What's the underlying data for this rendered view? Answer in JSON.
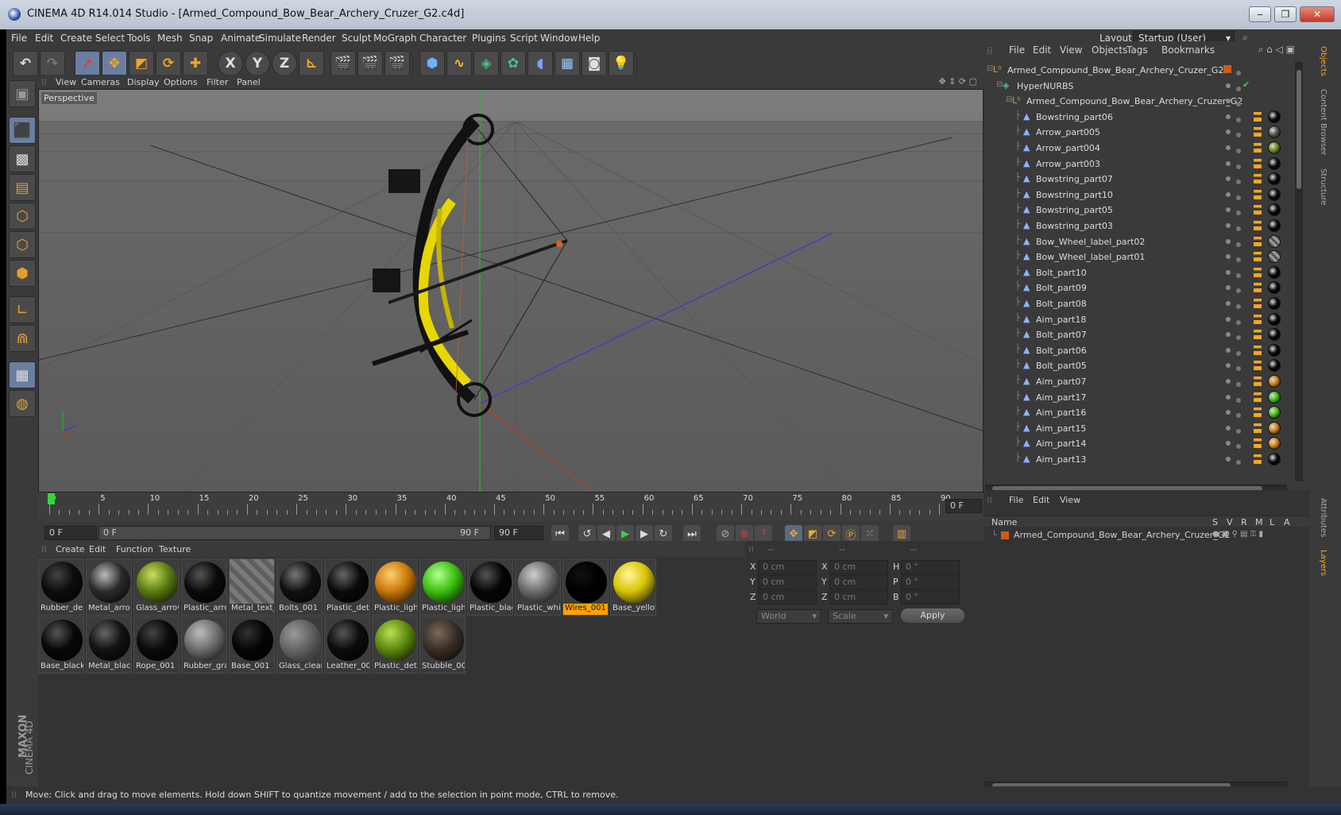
{
  "window": {
    "title": "CINEMA 4D R14.014 Studio - [Armed_Compound_Bow_Bear_Archery_Cruzer_G2.c4d]"
  },
  "menubar": {
    "items": [
      "File",
      "Edit",
      "Create",
      "Select",
      "Tools",
      "Mesh",
      "Snap",
      "Animate",
      "Simulate",
      "Render",
      "Sculpt",
      "MoGraph",
      "Character",
      "Plugins",
      "Script",
      "Window",
      "Help"
    ],
    "layout_label": "Layout:",
    "layout_value": "Startup (User)"
  },
  "toolbar": {
    "axis_x": "X",
    "axis_y": "Y",
    "axis_z": "Z"
  },
  "viewport": {
    "menu": [
      "View",
      "Cameras",
      "Display",
      "Options",
      "Filter",
      "Panel"
    ],
    "label": "Perspective"
  },
  "timeline": {
    "ticks": [
      "0",
      "5",
      "10",
      "15",
      "20",
      "25",
      "30",
      "35",
      "40",
      "45",
      "50",
      "55",
      "60",
      "65",
      "70",
      "75",
      "80",
      "85",
      "90"
    ],
    "current_frame": "0 F",
    "start_field": "0 F",
    "range_start": "0 F",
    "range_end": "90 F",
    "end_field": "90 F"
  },
  "materials": {
    "menu": [
      "Create",
      "Edit",
      "Function",
      "Texture"
    ],
    "row1": [
      {
        "label": "Rubber_de",
        "color": "#0c0c0c",
        "hi": "#444"
      },
      {
        "label": "Metal_arro",
        "color": "#2b2b2b",
        "hi": "#bbb"
      },
      {
        "label": "Glass_arrov",
        "color": "#5a7a12",
        "hi": "#c8e060"
      },
      {
        "label": "Plastic_arro",
        "color": "#0a0a0a",
        "hi": "#555"
      },
      {
        "label": "Metal_text_",
        "color": "stripe",
        "hi": "#999"
      },
      {
        "label": "Bolts_001",
        "color": "#111",
        "hi": "#777"
      },
      {
        "label": "Plastic_deta",
        "color": "#0a0a0a",
        "hi": "#666"
      },
      {
        "label": "Plastic_ligh",
        "color": "#c87808",
        "hi": "#ffcf70"
      },
      {
        "label": "Plastic_ligh",
        "color": "#3ac010",
        "hi": "#b8ff90"
      },
      {
        "label": "Plastic_blac",
        "color": "#050505",
        "hi": "#555"
      },
      {
        "label": "Plastic_whi",
        "color": "#6c6c6c",
        "hi": "#cfcfcf"
      },
      {
        "label": "Wires_001",
        "color": "#000",
        "hi": "#111",
        "selected": true
      },
      {
        "label": "Base_yellov",
        "color": "#d8c400",
        "hi": "#fff7a0"
      }
    ],
    "row2": [
      {
        "label": "Base_black",
        "color": "#080808",
        "hi": "#555"
      },
      {
        "label": "Metal_blac",
        "color": "#121212",
        "hi": "#666"
      },
      {
        "label": "Rope_001",
        "color": "#0a0a0a",
        "hi": "#444"
      },
      {
        "label": "Rubber_gra",
        "color": "#6d6d6d",
        "hi": "#bdbdbd"
      },
      {
        "label": "Base_001",
        "color": "#050505",
        "hi": "#333"
      },
      {
        "label": "Glass_clear",
        "color": "stripe2",
        "hi": "#aaa"
      },
      {
        "label": "Leather_00",
        "color": "#0b0b0b",
        "hi": "#555"
      },
      {
        "label": "Plastic_deta",
        "color": "#5c8a10",
        "hi": "#b8e050"
      },
      {
        "label": "Stubble_00",
        "color": "#3a2e26",
        "hi": "#7a6a5c"
      }
    ]
  },
  "coordinates": {
    "header": [
      "--",
      "--",
      "--"
    ],
    "rows": [
      {
        "a": "X",
        "av": "0 cm",
        "b": "X",
        "bv": "0 cm",
        "c": "H",
        "cv": "0 °"
      },
      {
        "a": "Y",
        "av": "0 cm",
        "b": "Y",
        "bv": "0 cm",
        "c": "P",
        "cv": "0 °"
      },
      {
        "a": "Z",
        "av": "0 cm",
        "b": "Z",
        "bv": "0 cm",
        "c": "B",
        "cv": "0 °"
      }
    ],
    "world": "World",
    "scale": "Scale",
    "apply": "Apply"
  },
  "objects": {
    "menu": [
      "File",
      "Edit",
      "View",
      "Objects",
      "Tags",
      "Bookmarks"
    ],
    "items": [
      {
        "name": "Armed_Compound_Bow_Bear_Archery_Cruzer_G2",
        "indent": 0,
        "icon": "null",
        "tag": "orange-square"
      },
      {
        "name": "HyperNURBS",
        "indent": 1,
        "icon": "nurbs",
        "tag": "check"
      },
      {
        "name": "Armed_Compound_Bow_Bear_Archery_Cruzer_G2",
        "indent": 2,
        "icon": "null",
        "tag": "none"
      },
      {
        "name": "Bowstring_part06",
        "indent": 3,
        "icon": "poly",
        "tag": "#0a0a0a"
      },
      {
        "name": "Arrow_part005",
        "indent": 3,
        "icon": "poly",
        "tag": "#555"
      },
      {
        "name": "Arrow_part004",
        "indent": 3,
        "icon": "poly",
        "tag": "#6a8a1a"
      },
      {
        "name": "Arrow_part003",
        "indent": 3,
        "icon": "poly",
        "tag": "#0a0a0a"
      },
      {
        "name": "Bowstring_part07",
        "indent": 3,
        "icon": "poly",
        "tag": "#0a0a0a"
      },
      {
        "name": "Bowstring_part10",
        "indent": 3,
        "icon": "poly",
        "tag": "#0a0a0a"
      },
      {
        "name": "Bowstring_part05",
        "indent": 3,
        "icon": "poly",
        "tag": "#0a0a0a"
      },
      {
        "name": "Bowstring_part03",
        "indent": 3,
        "icon": "poly",
        "tag": "#0a0a0a"
      },
      {
        "name": "Bow_Wheel_label_part02",
        "indent": 3,
        "icon": "poly",
        "tag": "stripe"
      },
      {
        "name": "Bow_Wheel_label_part01",
        "indent": 3,
        "icon": "poly",
        "tag": "stripe"
      },
      {
        "name": "Bolt_part10",
        "indent": 3,
        "icon": "poly",
        "tag": "#0a0a0a"
      },
      {
        "name": "Bolt_part09",
        "indent": 3,
        "icon": "poly",
        "tag": "#0a0a0a"
      },
      {
        "name": "Bolt_part08",
        "indent": 3,
        "icon": "poly",
        "tag": "#0a0a0a"
      },
      {
        "name": "Aim_part18",
        "indent": 3,
        "icon": "poly",
        "tag": "#0a0a0a"
      },
      {
        "name": "Bolt_part07",
        "indent": 3,
        "icon": "poly",
        "tag": "#0a0a0a"
      },
      {
        "name": "Bolt_part06",
        "indent": 3,
        "icon": "poly",
        "tag": "#0a0a0a"
      },
      {
        "name": "Bolt_part05",
        "indent": 3,
        "icon": "poly",
        "tag": "#0a0a0a"
      },
      {
        "name": "Aim_part07",
        "indent": 3,
        "icon": "poly",
        "tag": "#d08010"
      },
      {
        "name": "Aim_part17",
        "indent": 3,
        "icon": "poly",
        "tag": "#40c010"
      },
      {
        "name": "Aim_part16",
        "indent": 3,
        "icon": "poly",
        "tag": "#40c010"
      },
      {
        "name": "Aim_part15",
        "indent": 3,
        "icon": "poly",
        "tag": "#d08010"
      },
      {
        "name": "Aim_part14",
        "indent": 3,
        "icon": "poly",
        "tag": "#d08010"
      },
      {
        "name": "Aim_part13",
        "indent": 3,
        "icon": "poly",
        "tag": "#0a0a0a"
      }
    ]
  },
  "layers": {
    "menu": [
      "File",
      "Edit",
      "View"
    ],
    "name_header": "Name",
    "cols": [
      "S",
      "V",
      "R",
      "M",
      "L",
      "A"
    ],
    "item": "Armed_Compound_Bow_Bear_Archery_Cruzer_G2"
  },
  "right_tabs": [
    "Objects",
    "Content Browser",
    "Structure",
    "Attributes",
    "Layers"
  ],
  "status": "Move: Click and drag to move elements. Hold down SHIFT to quantize movement / add to the selection in point mode, CTRL to remove.",
  "brand": {
    "line1": "MAXON",
    "line2": "CINEMA 4D"
  }
}
